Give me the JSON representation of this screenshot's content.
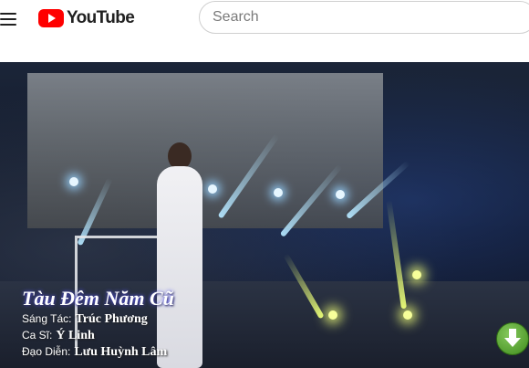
{
  "header": {
    "menu_icon": "hamburger-menu-icon",
    "logo_text": "YouTube",
    "logo_icon": "youtube-play-icon",
    "search": {
      "placeholder": "Search",
      "value": ""
    }
  },
  "video": {
    "overlay_title": "Tàu Đêm Năm Cũ",
    "credits": [
      {
        "label": "Sáng Tác:",
        "value": "Trúc Phương"
      },
      {
        "label": "Ca Sĩ:",
        "value": "Ý Linh"
      },
      {
        "label": "Đạo Diễn:",
        "value": "Lưu Huỳnh Lâm"
      }
    ],
    "download_icon": "download-arrow-icon"
  },
  "colors": {
    "brand_red": "#ff0000",
    "download_green": "#4c9a2a"
  }
}
